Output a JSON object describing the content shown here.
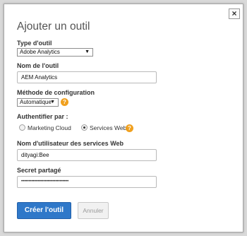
{
  "dialog": {
    "title": "Ajouter un outil",
    "close_label": "×"
  },
  "form": {
    "tool_type": {
      "label": "Type d'outil",
      "selected": "Adobe Analytics"
    },
    "tool_name": {
      "label": "Nom de l'outil",
      "value": "AEM Analytics"
    },
    "config_method": {
      "label": "Méthode de configuration",
      "selected": "Automatique"
    },
    "auth": {
      "label": "Authentifier par :",
      "options": [
        {
          "label": "Marketing Cloud",
          "checked": false
        },
        {
          "label": "Services Web",
          "checked": true
        }
      ]
    },
    "ws_username": {
      "label": "Nom d'utilisateur des services Web",
      "value": "dityagi:Bee"
    },
    "shared_secret": {
      "label": "Secret partagé",
      "value": "••••••••••••••••••••••••••••••••"
    }
  },
  "buttons": {
    "create": "Créer l'outil",
    "cancel": "Annuler"
  },
  "help_icon_glyph": "?",
  "select_arrow_glyph": "▼",
  "colors": {
    "primary": "#2f78c9",
    "help": "#f0a01e"
  }
}
